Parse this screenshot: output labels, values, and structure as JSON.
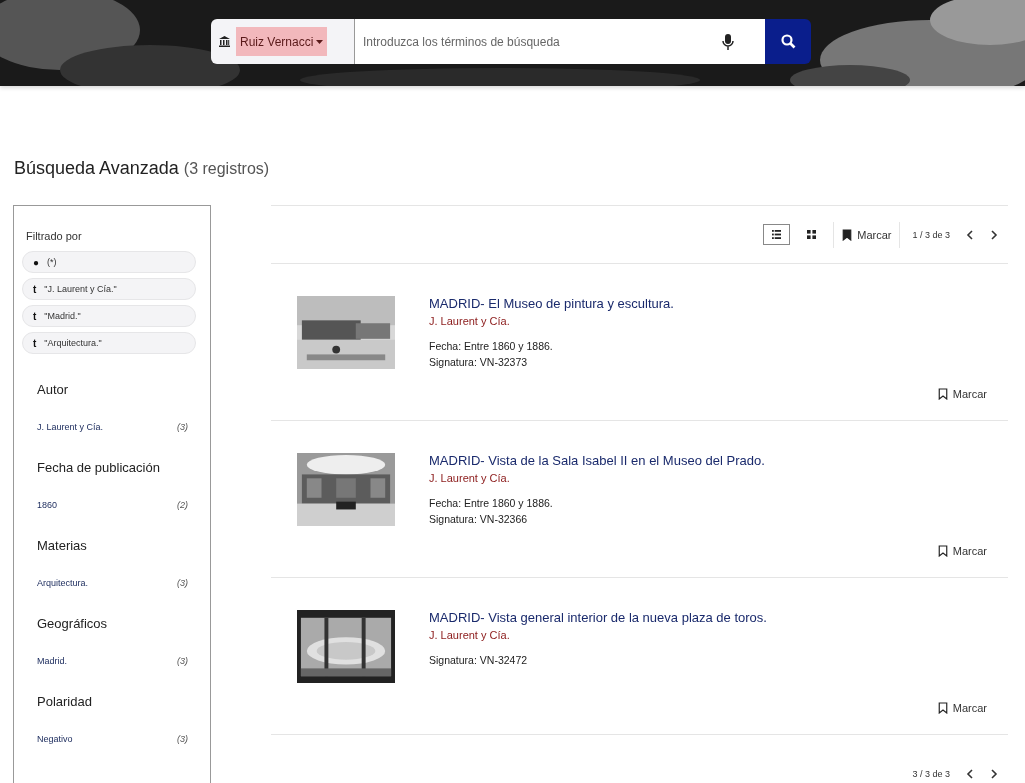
{
  "search": {
    "scope": "Ruiz Vernacci",
    "placeholder": "Introduzca los términos de búsqueda"
  },
  "heading": {
    "title": "Búsqueda Avanzada",
    "count": "(3 registros)"
  },
  "filters": {
    "title": "Filtrado por",
    "chips": [
      {
        "icon": "●",
        "label": "(*)"
      },
      {
        "icon": "t",
        "label": "\"J. Laurent y Cía.\""
      },
      {
        "icon": "t",
        "label": "\"Madrid.\""
      },
      {
        "icon": "t",
        "label": "\"Arquitectura.\""
      }
    ],
    "facets": [
      {
        "title": "Autor",
        "items": [
          {
            "label": "J. Laurent y Cía.",
            "count": "(3)"
          }
        ]
      },
      {
        "title": "Fecha de publicación",
        "items": [
          {
            "label": "1860",
            "count": "(2)"
          }
        ]
      },
      {
        "title": "Materias",
        "items": [
          {
            "label": "Arquitectura.",
            "count": "(3)"
          }
        ]
      },
      {
        "title": "Geográficos",
        "items": [
          {
            "label": "Madrid.",
            "count": "(3)"
          }
        ]
      },
      {
        "title": "Polaridad",
        "items": [
          {
            "label": "Negativo",
            "count": "(3)"
          }
        ]
      }
    ]
  },
  "toolbar": {
    "views": [
      {
        "kind": "list",
        "selected": true
      },
      {
        "kind": "grid",
        "selected": false
      }
    ],
    "mark": "Marcar",
    "pages": "1 / 3 de 3"
  },
  "results": [
    {
      "title": "MADRID- El Museo de pintura y escultura.",
      "author": "J. Laurent y Cía.",
      "fields": [
        {
          "label": "Fecha:",
          "value": "Entre 1860 y 1886."
        },
        {
          "label": "Signatura:",
          "value": "VN-32373"
        }
      ],
      "mark": "Marcar"
    },
    {
      "title": "MADRID- Vista de la Sala Isabel II en el Museo del Prado.",
      "author": "J. Laurent y Cía.",
      "fields": [
        {
          "label": "Fecha:",
          "value": "Entre 1860 y 1886."
        },
        {
          "label": "Signatura:",
          "value": "VN-32366"
        }
      ],
      "mark": "Marcar"
    },
    {
      "title": "MADRID- Vista general interior de la nueva plaza de toros.",
      "author": "J. Laurent y Cía.",
      "fields": [
        {
          "label": "Signatura:",
          "value": "VN-32472"
        }
      ],
      "mark": "Marcar"
    }
  ],
  "footer": {
    "pages": "3 / 3 de 3"
  }
}
